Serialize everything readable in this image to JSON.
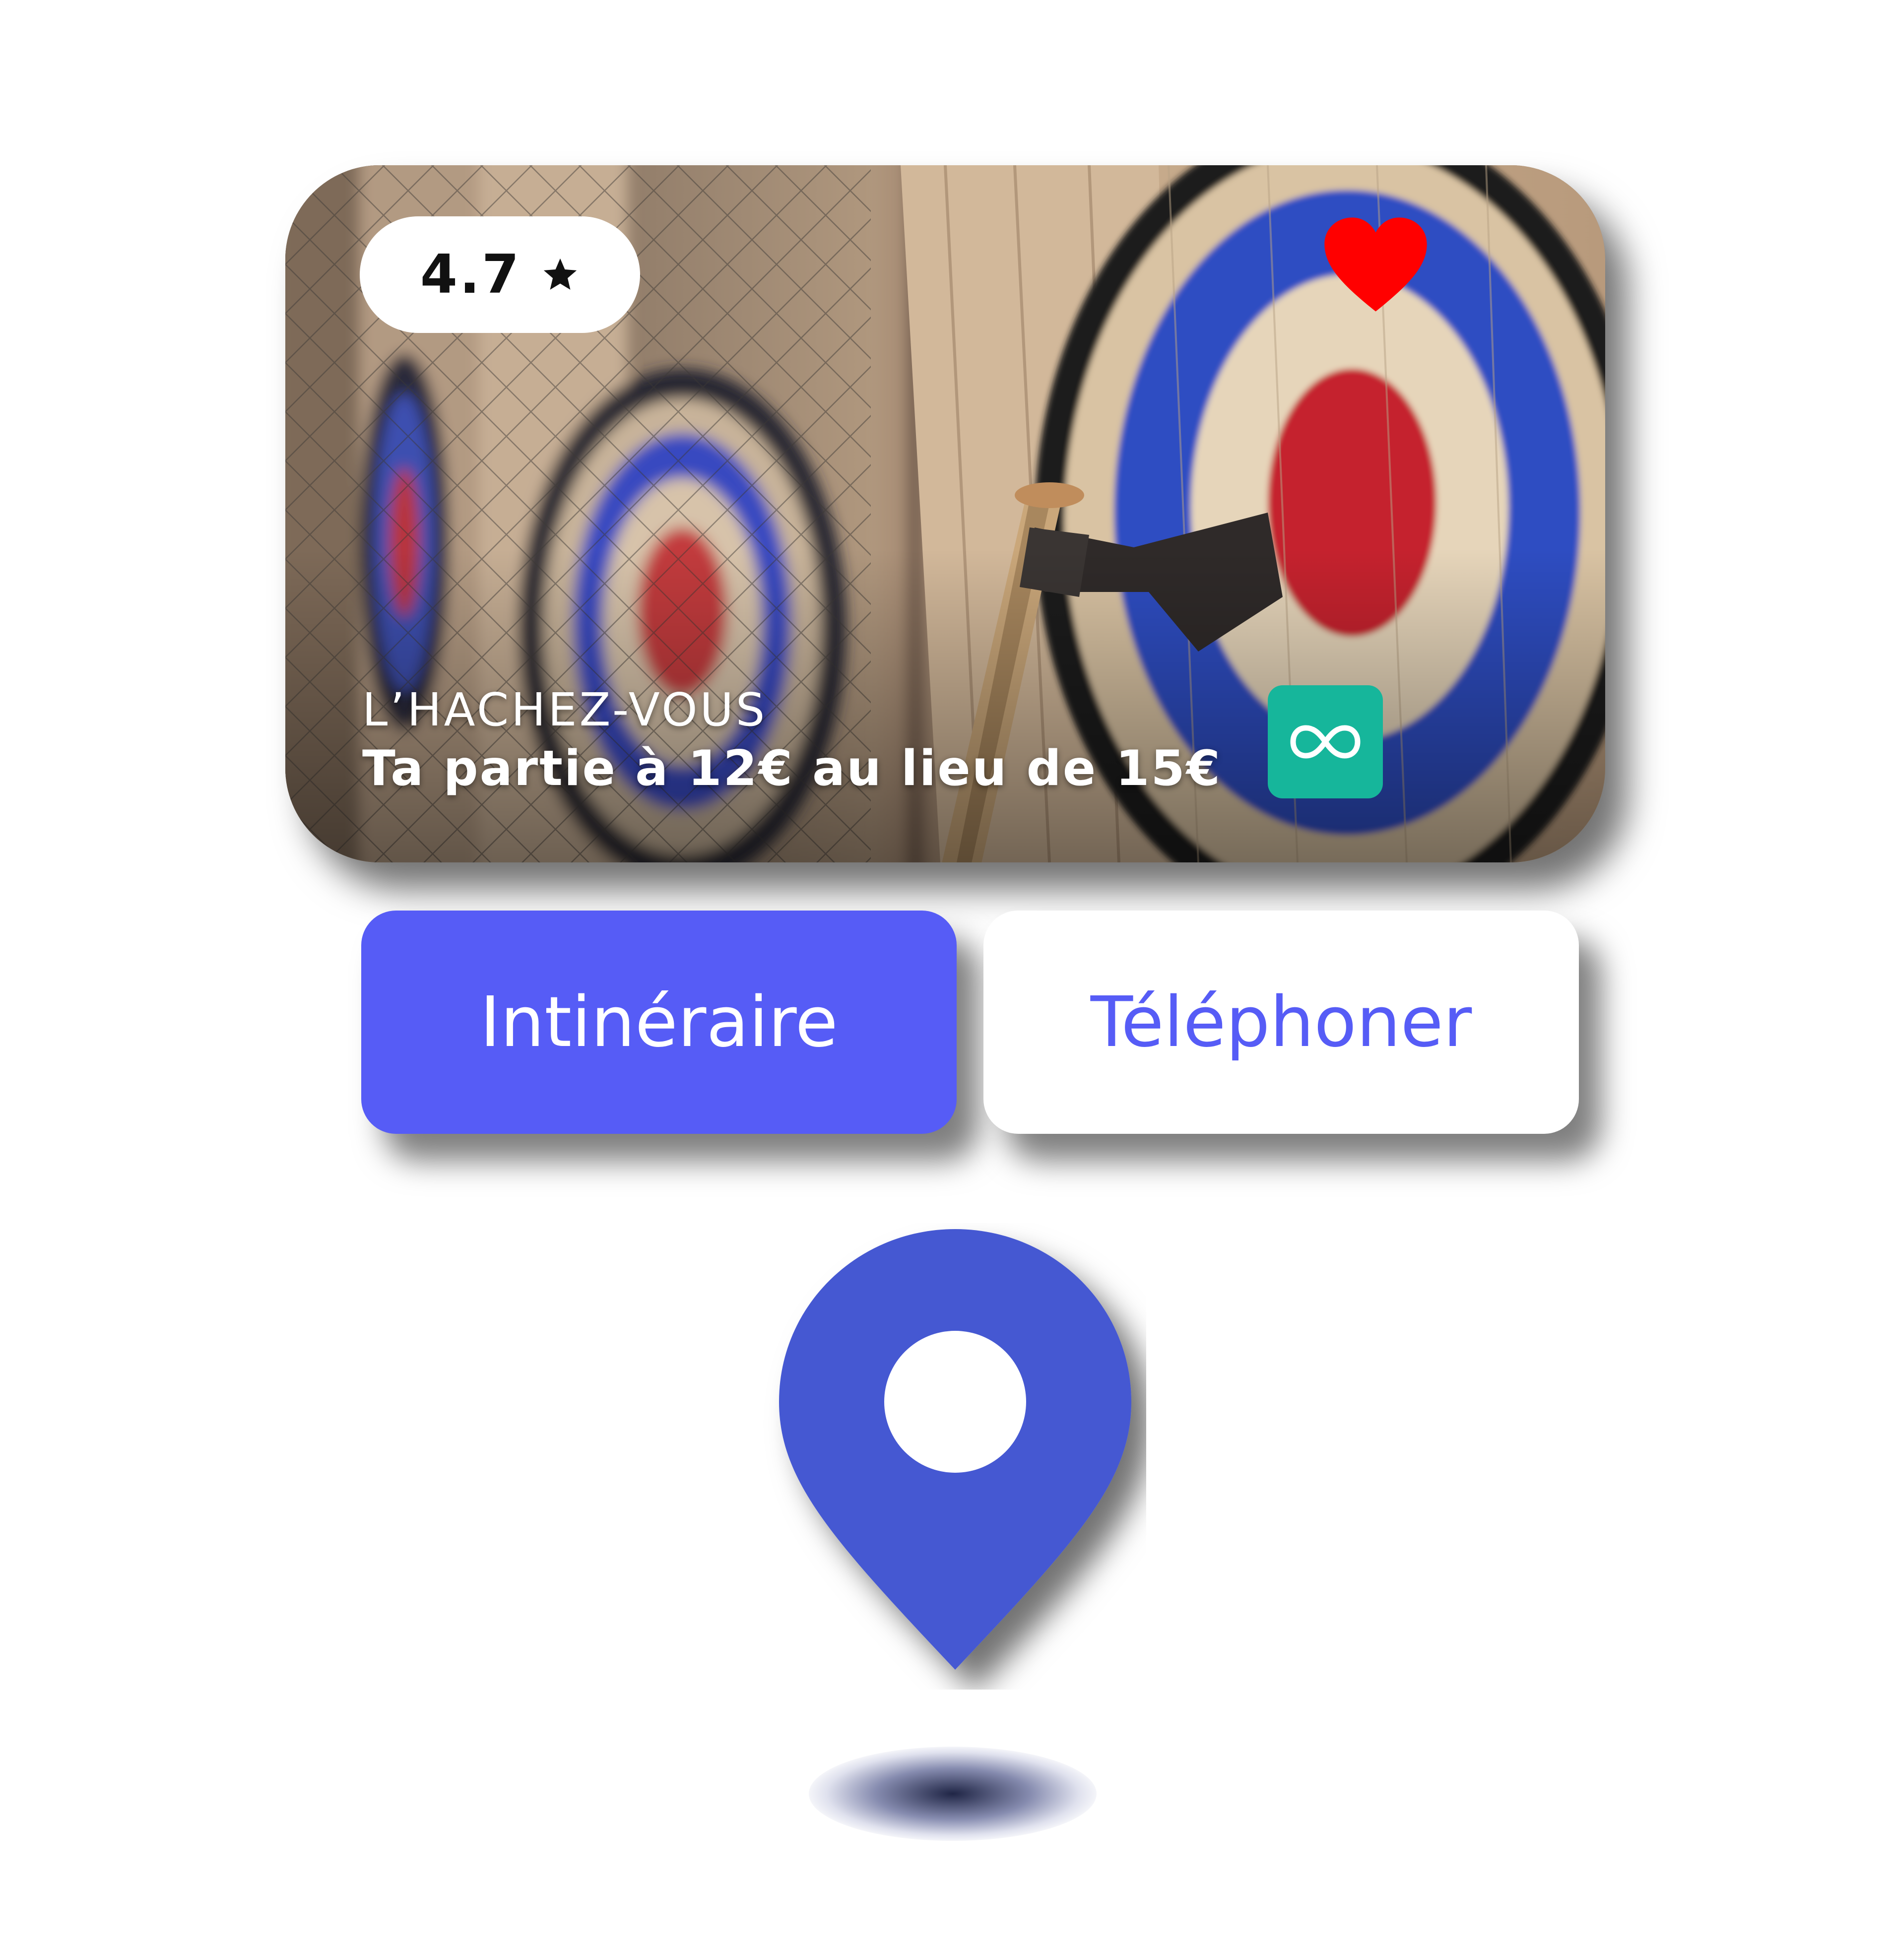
{
  "card": {
    "rating": "4.7",
    "venue_name": "L’HACHEZ-VOUS",
    "offer": "Ta partie à 12€ au lieu de 15€",
    "badge_icon": "infinity-icon",
    "favorite_icon": "heart-icon",
    "favorite_color": "#ff0000",
    "badge_color": "#16b69b"
  },
  "actions": {
    "directions_label": "Intinéraire",
    "call_label": "Téléphoner",
    "accent_color": "#565cf6"
  },
  "map_pin": {
    "icon": "map-pin-icon",
    "color": "#4558d2"
  }
}
